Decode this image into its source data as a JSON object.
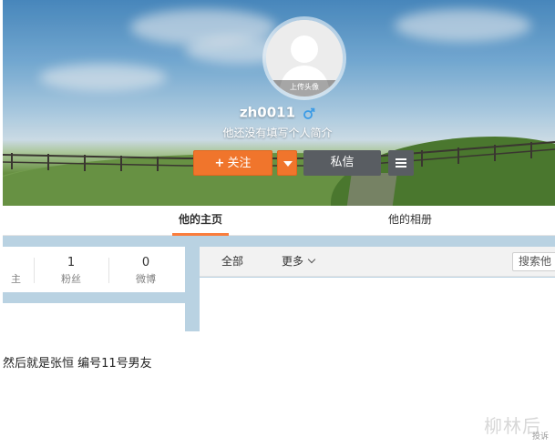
{
  "profile": {
    "avatar_upload_label": "上传头像",
    "username": "zh0011",
    "bio": "他还没有填写个人简介",
    "follow_label": "关注",
    "follow_plus": "+",
    "message_label": "私信"
  },
  "tabs": {
    "home": "他的主页",
    "album": "他的相册"
  },
  "stats": [
    {
      "value": "1",
      "label": "粉丝"
    },
    {
      "value": "0",
      "label": "微博"
    }
  ],
  "stats_partial_label": "主",
  "feed": {
    "all_label": "全部",
    "more_label": "更多",
    "search_placeholder": "搜索他"
  },
  "caption": "然后就是张恒 编号11号男友",
  "watermark": {
    "main": "柳林后",
    "sub": "投诉"
  },
  "colors": {
    "follow": "#f0752c",
    "dark_button": "#595d62",
    "active_tab_underline": "#fa7d3c",
    "gender_icon": "#3b9be6"
  }
}
